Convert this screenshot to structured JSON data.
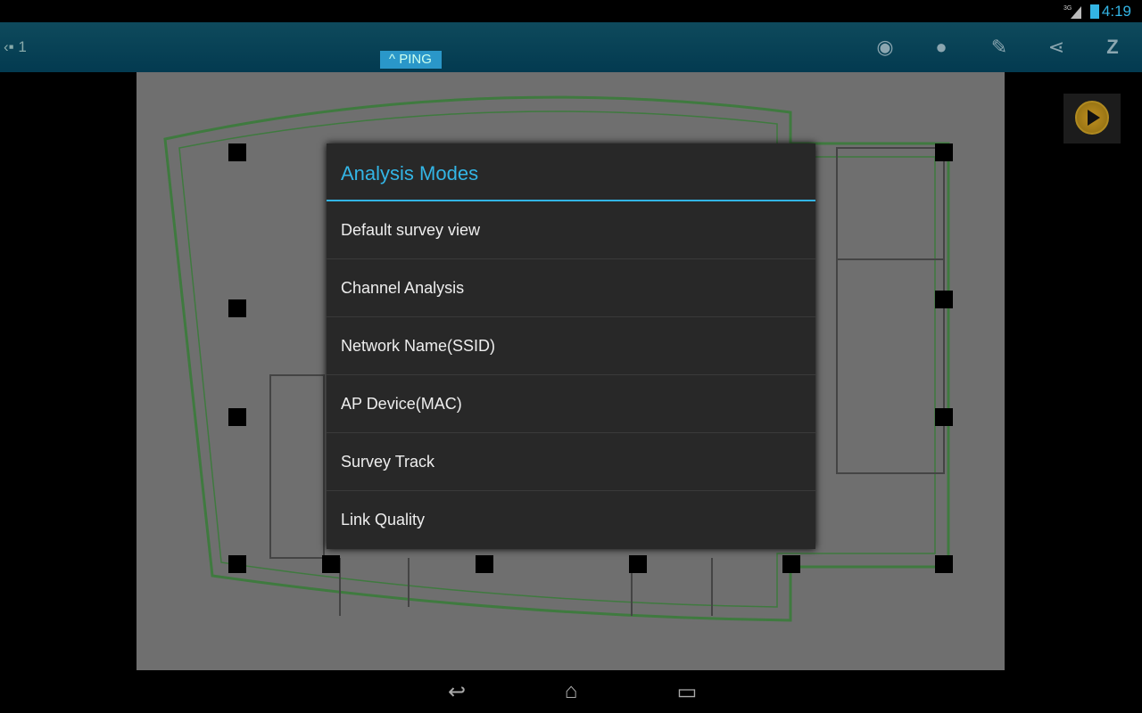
{
  "status": {
    "time": "4:19",
    "network": "3G"
  },
  "actionbar": {
    "page_number": "1",
    "ping_label": "PING",
    "icons": [
      "eye-icon",
      "layers-icon",
      "edit-icon",
      "share-icon",
      "zoom-icon"
    ]
  },
  "dialog": {
    "title": "Analysis Modes",
    "items": [
      "Default survey view",
      "Channel Analysis",
      "Network Name(SSID)",
      "AP Device(MAC)",
      "Survey Track",
      "Link Quality"
    ]
  },
  "colors": {
    "accent": "#33b5e5",
    "actionbar": "#033a50",
    "dialog_bg": "#282828"
  }
}
